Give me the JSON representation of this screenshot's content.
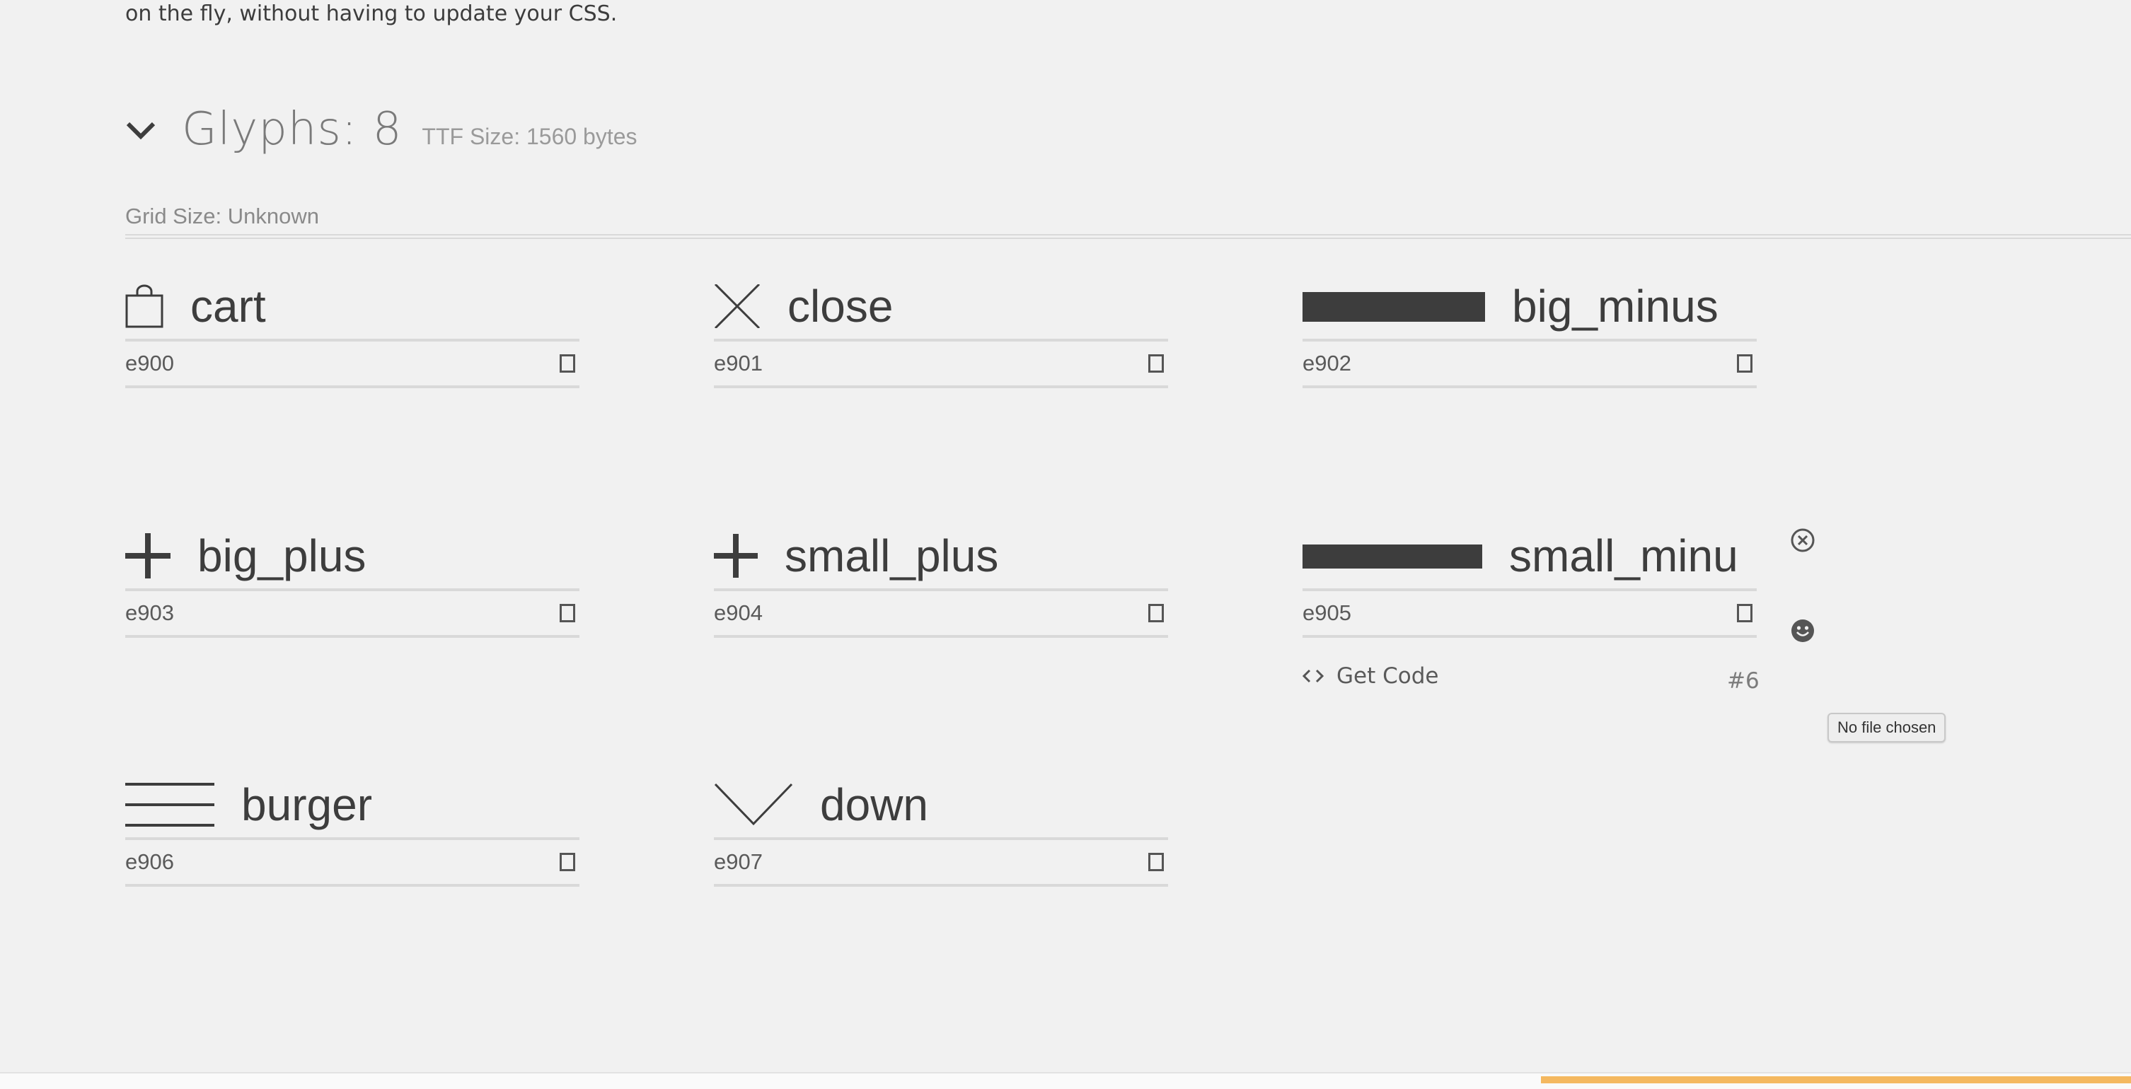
{
  "intro_text": "on the fly, without having to update your CSS.",
  "header": {
    "glyphs_label": "Glyphs:",
    "glyphs_count": "8",
    "ttf_size": "TTF Size: 1560 bytes"
  },
  "grid_size": "Grid Size: Unknown",
  "glyphs": [
    {
      "name": "cart",
      "code": "e900",
      "icon": "cart-icon"
    },
    {
      "name": "close",
      "code": "e901",
      "icon": "close-icon"
    },
    {
      "name": "big_minus",
      "code": "e902",
      "icon": "big-minus-icon"
    },
    {
      "name": "big_plus",
      "code": "e903",
      "icon": "big-plus-icon"
    },
    {
      "name": "small_plus",
      "code": "e904",
      "icon": "small-plus-icon"
    },
    {
      "name": "small_minu",
      "code": "e905",
      "icon": "small-minus-icon"
    },
    {
      "name": "burger",
      "code": "e906",
      "icon": "burger-icon"
    },
    {
      "name": "down",
      "code": "e907",
      "icon": "down-icon"
    }
  ],
  "selected_glyph": {
    "get_code_label": "Get Code",
    "index_label": "#6"
  },
  "tooltip": "No file chosen",
  "colors": {
    "background": "#f1f1f1",
    "icon": "#3d3d3d",
    "accent": "#f4b860"
  }
}
